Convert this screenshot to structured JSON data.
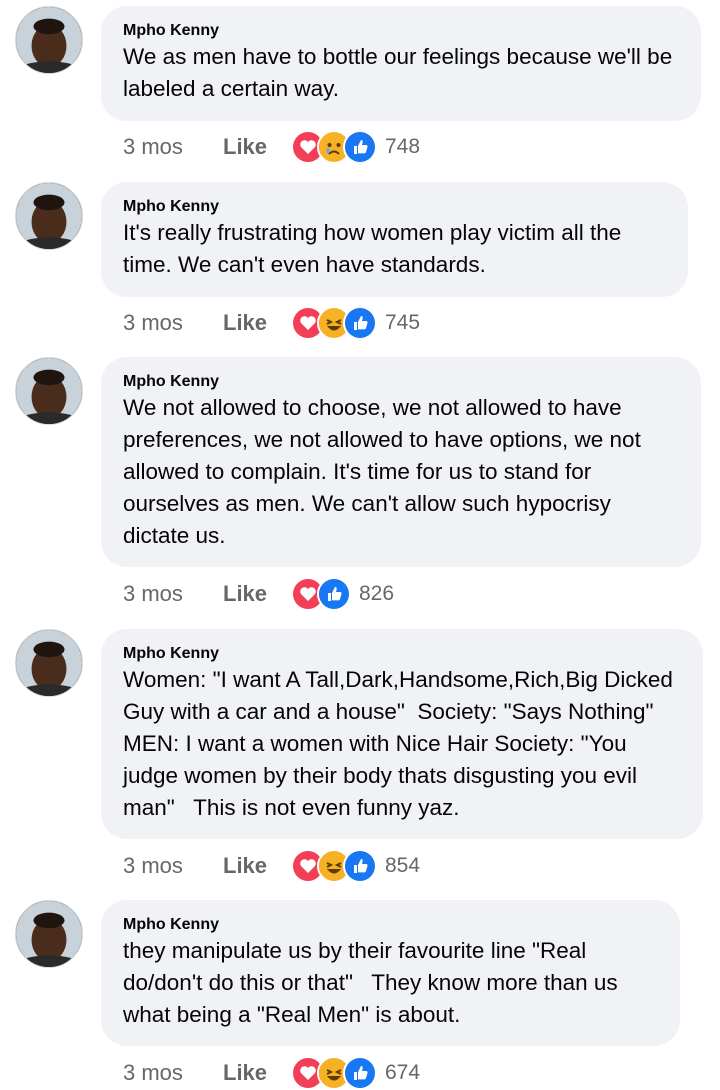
{
  "comments": [
    {
      "author": "Mpho Kenny",
      "text": "We as men have to bottle our feelings because we'll be labeled a certain way.",
      "time": "3 mos",
      "like_label": "Like",
      "reactions": [
        "love",
        "sad",
        "like"
      ],
      "reaction_count": "748"
    },
    {
      "author": "Mpho Kenny",
      "text": "It's really frustrating how women play victim all the time. We can't even have standards.",
      "time": "3 mos",
      "like_label": "Like",
      "reactions": [
        "love",
        "haha",
        "like"
      ],
      "reaction_count": "745"
    },
    {
      "author": "Mpho Kenny",
      "text": "We not allowed to choose, we not allowed to have preferences, we not allowed to have options, we not allowed to complain. It's time for us to stand for ourselves as men. We can't allow such hypocrisy dictate us.",
      "time": "3 mos",
      "like_label": "Like",
      "reactions": [
        "love",
        "like"
      ],
      "reaction_count": "826"
    },
    {
      "author": "Mpho Kenny",
      "text": "Women: \"I want A Tall,Dark,Handsome,Rich,Big Dicked Guy with a car and a house\"  Society: \"Says Nothing\"  MEN: I want a women with Nice Hair Society: \"You judge women by their body thats disgusting you evil man\"   This is not even funny yaz.",
      "time": "3 mos",
      "like_label": "Like",
      "reactions": [
        "love",
        "haha",
        "like"
      ],
      "reaction_count": "854"
    },
    {
      "author": "Mpho Kenny",
      "text": "they manipulate us by their favourite line \"Real do/don't do this or that\"   They know more than us what being a \"Real Men\" is about.",
      "time": "3 mos",
      "like_label": "Like",
      "reactions": [
        "love",
        "haha",
        "like"
      ],
      "reaction_count": "674"
    }
  ],
  "colors": {
    "bubble": "#f0f2f5",
    "meta_text": "#65676b",
    "love": "#f33e58",
    "like": "#1877f2",
    "haha": "#f7b125"
  }
}
